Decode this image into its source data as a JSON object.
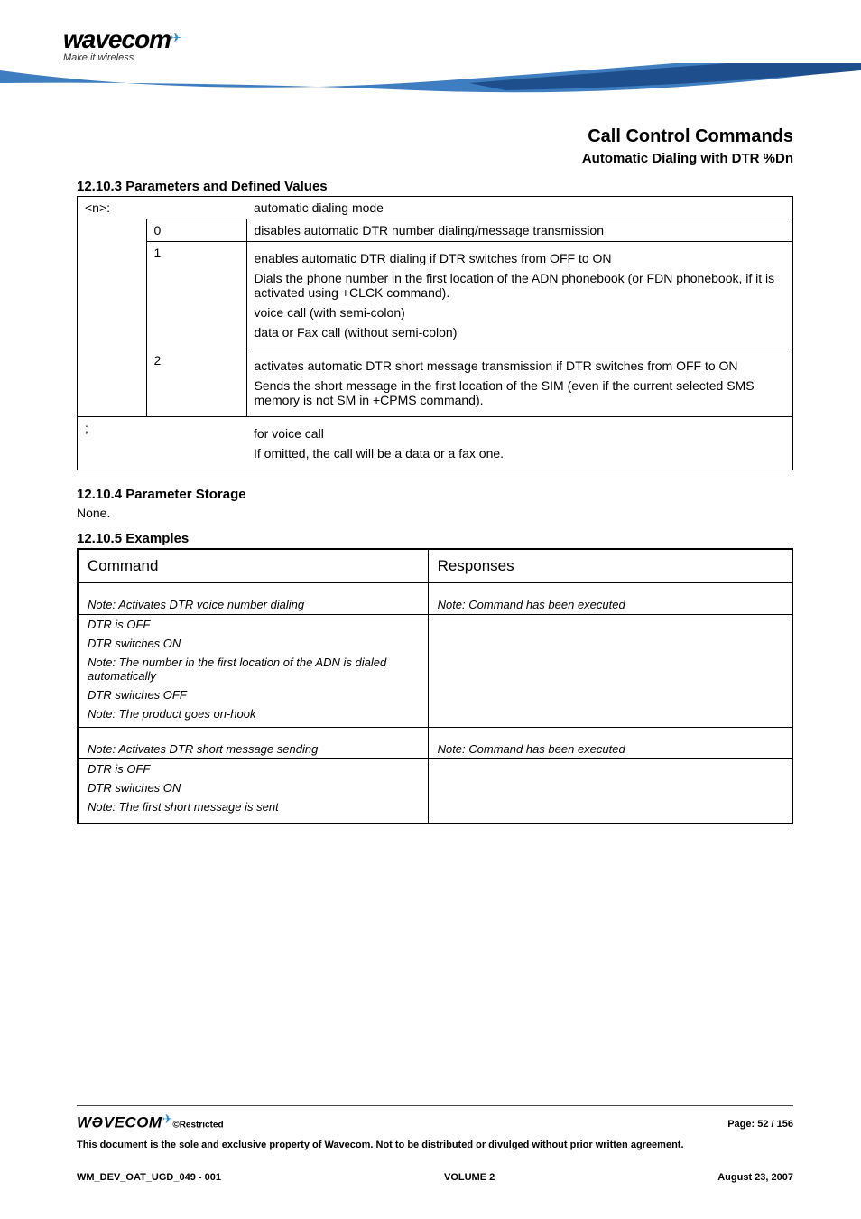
{
  "header": {
    "logo_text": "wavecom",
    "logo_tagline": "Make it wireless",
    "title1": "Call Control Commands",
    "title2": "Automatic Dialing with DTR %Dn"
  },
  "sections": {
    "h_params": "12.10.3  Parameters and Defined Values",
    "h_storage": "12.10.4  Parameter Storage",
    "storage_body": "None.",
    "h_examples": "12.10.5  Examples"
  },
  "params": {
    "n_key": "<n>:",
    "n_desc": "automatic dialing mode",
    "v0": "0",
    "v0_desc": "disables automatic DTR number dialing/message transmission",
    "v1": "1",
    "v1_desc_a": "enables automatic DTR dialing if DTR switches from OFF to ON",
    "v1_desc_b": "Dials the phone number in the first location of the ADN phonebook (or FDN phonebook, if it is activated using +CLCK command).",
    "v1_desc_c": "voice call (with semi-colon)",
    "v1_desc_d": "data or Fax call (without semi-colon)",
    "v2": "2",
    "v2_desc_a": "activates automatic DTR short message transmission if DTR switches from OFF to ON",
    "v2_desc_b": "Sends the short message in the first location of the SIM (even if the current selected SMS memory is not SM in +CPMS command).",
    "semi_key": ";",
    "semi_desc_a": "for voice call",
    "semi_desc_b": "If omitted, the call will be a data or a fax one."
  },
  "examples": {
    "col_command": "Command",
    "col_responses": "Responses",
    "r1_cmd_note": "Note: Activates DTR voice number dialing",
    "r1_resp_note": "Note: Command has been executed",
    "r2_a": "DTR is OFF",
    "r2_b": "DTR switches ON",
    "r2_c": "Note: The number in the first location of the ADN is dialed automatically",
    "r2_d": "DTR switches OFF",
    "r2_e": "Note: The product goes on-hook",
    "r3_cmd_note": "Note: Activates DTR short message sending",
    "r3_resp_note": "Note: Command has been executed",
    "r4_a": "DTR is OFF",
    "r4_b": "DTR switches ON",
    "r4_c": "Note: The first short message is sent"
  },
  "footer": {
    "logo": "WƏVECOM",
    "restricted": "©Restricted",
    "page_label": "Page: ",
    "page_num": "52",
    "page_sep": " / ",
    "page_total": "156",
    "property": "This document is the sole and exclusive property of Wavecom. Not to be distributed or divulged without prior written agreement.",
    "doc_id": "WM_DEV_OAT_UGD_049 - 001",
    "volume": "VOLUME 2",
    "date": "August 23, 2007"
  }
}
